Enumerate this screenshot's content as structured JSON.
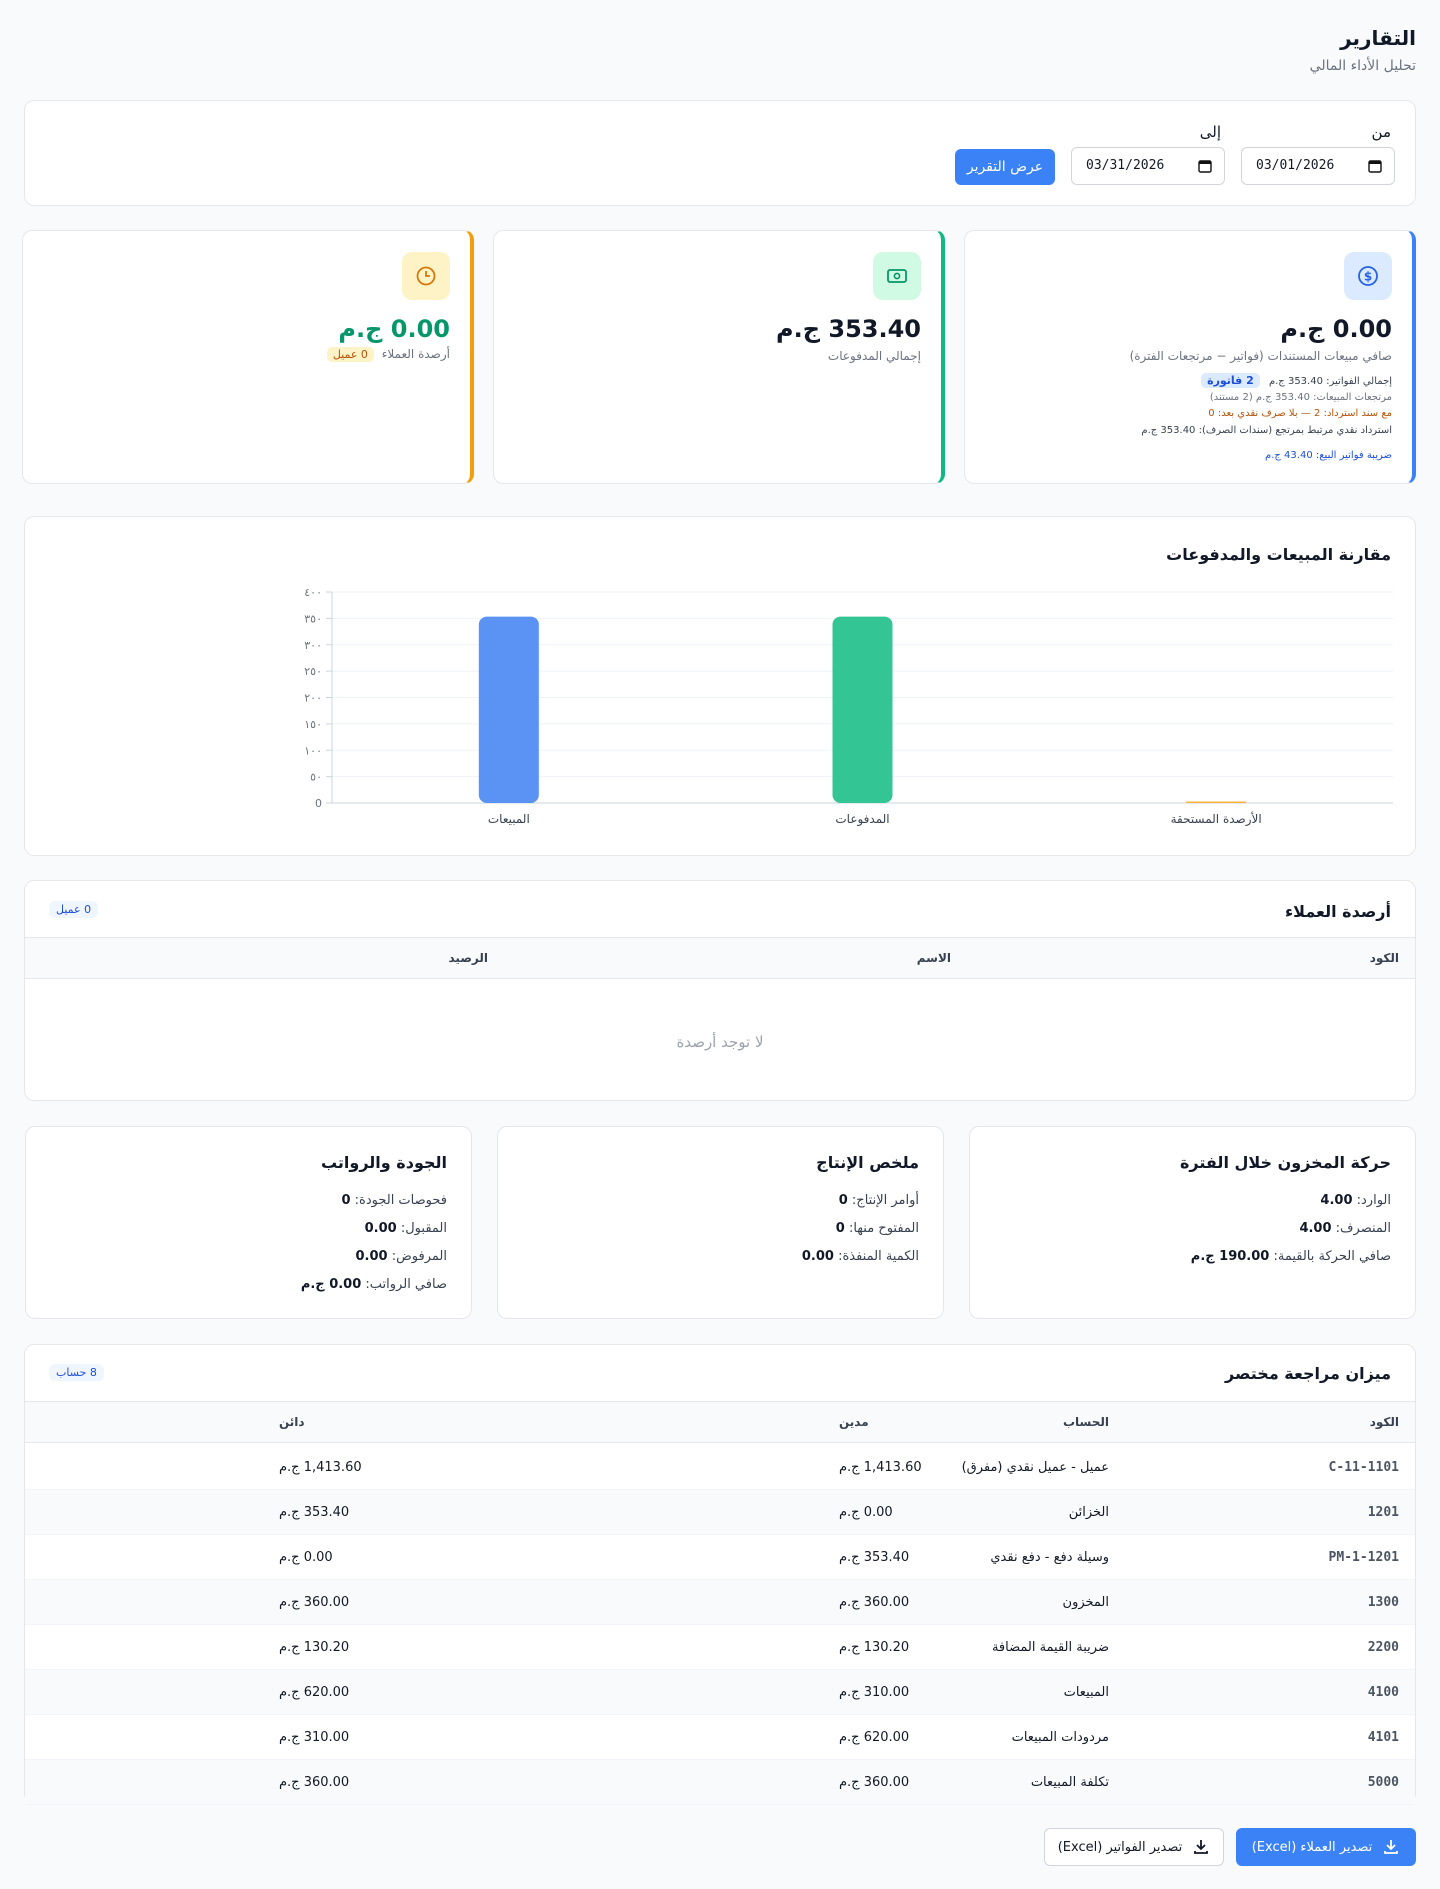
{
  "page": {
    "title": "التقارير",
    "subtitle": "تحليل الأداء المالي"
  },
  "filter": {
    "from_label": "من",
    "to_label": "إلى",
    "from_value": "03/01/2026",
    "to_value": "03/31/2026",
    "show_button": "عرض التقرير"
  },
  "kpis": {
    "net_sales": {
      "value": "0.00 ج.م",
      "label": "صافي مبيعات المستندات (فواتير − مرتجعات الفترة)",
      "invoices_total": "إجمالي الفواتير: 353.40 ج.م",
      "invoices_count": "2 فاتورة",
      "returns": "مرتجعات المبيعات: 353.40 ج.م (2 مستند)",
      "refund_note": "مع سند استرداد: 2 — بلا صرف نقدي بعد: 0",
      "cash_refund": "استرداد نقدي مرتبط بمرتجع (سندات الصرف): 353.40 ج.م",
      "sales_tax": "ضريبة فواتير البيع: 43.40 ج.م",
      "icon": "dollar-icon"
    },
    "payments": {
      "value": "353.40 ج.م",
      "label": "إجمالي المدفوعات",
      "icon": "banknote-icon"
    },
    "balances": {
      "value": "0.00 ج.م",
      "label": "أرصدة العملاء",
      "badge": "0 عميل",
      "icon": "clock-icon"
    }
  },
  "chart_data": {
    "type": "bar",
    "title": "مقارنة المبيعات والمدفوعات",
    "categories": [
      "المبيعات",
      "المدفوعات",
      "الأرصدة المستحقة"
    ],
    "values": [
      353.4,
      353.4,
      0
    ],
    "colors": [
      "#5b93f5",
      "#34c594",
      "#f5b33a"
    ],
    "ylim": [
      0,
      400
    ],
    "yticks": [
      "0",
      "٥٠",
      "١٠٠",
      "١٥٠",
      "٢٠٠",
      "٢٥٠",
      "٣٠٠",
      "٣٥٠",
      "٤٠٠"
    ],
    "grid": true
  },
  "customers": {
    "title": "أرصدة العملاء",
    "badge": "0 عميل",
    "columns": [
      "الكود",
      "الاسم",
      "الرصيد"
    ],
    "empty": "لا توجد أرصدة"
  },
  "inventory": {
    "title": "حركة المخزون خلال الفترة",
    "in_label": "الوارد:",
    "in_value": "4.00",
    "out_label": "المنصرف:",
    "out_value": "4.00",
    "net_label": "صافي الحركة بالقيمة:",
    "net_value": "190.00 ج.م"
  },
  "production": {
    "title": "ملخص الإنتاج",
    "orders_label": "أوامر الإنتاج:",
    "orders_value": "0",
    "open_label": "المفتوح منها:",
    "open_value": "0",
    "qty_label": "الكمية المنفذة:",
    "qty_value": "0.00"
  },
  "quality": {
    "title": "الجودة والرواتب",
    "checks_label": "فحوصات الجودة:",
    "checks_value": "0",
    "accepted_label": "المقبول:",
    "accepted_value": "0.00",
    "rejected_label": "المرفوض:",
    "rejected_value": "0.00",
    "payroll_label": "صافي الرواتب:",
    "payroll_value": "0.00 ج.م"
  },
  "trial_balance": {
    "title": "ميزان مراجعة مختصر",
    "badge": "8 حساب",
    "columns": [
      "الكود",
      "الحساب",
      "مدين",
      "دائن"
    ],
    "rows": [
      {
        "code": "C-11-1101",
        "account": "عميل - عميل نقدي (مفرق)",
        "debit": "1,413.60 ج.م",
        "credit": "1,413.60 ج.م"
      },
      {
        "code": "1201",
        "account": "الخزائن",
        "debit": "0.00 ج.م",
        "credit": "353.40 ج.م"
      },
      {
        "code": "PM-1-1201",
        "account": "وسيلة دفع - دفع نقدي",
        "debit": "353.40 ج.م",
        "credit": "0.00 ج.م"
      },
      {
        "code": "1300",
        "account": "المخزون",
        "debit": "360.00 ج.م",
        "credit": "360.00 ج.م"
      },
      {
        "code": "2200",
        "account": "ضريبة القيمة المضافة",
        "debit": "130.20 ج.م",
        "credit": "130.20 ج.م"
      },
      {
        "code": "4100",
        "account": "المبيعات",
        "debit": "310.00 ج.م",
        "credit": "620.00 ج.م"
      },
      {
        "code": "4101",
        "account": "مردودات المبيعات",
        "debit": "620.00 ج.م",
        "credit": "310.00 ج.م"
      },
      {
        "code": "5000",
        "account": "تكلفة المبيعات",
        "debit": "360.00 ج.م",
        "credit": "360.00 ج.م"
      }
    ]
  },
  "exports": {
    "customers": "تصدير العملاء (Excel)",
    "invoices": "تصدير الفواتير (Excel)"
  }
}
